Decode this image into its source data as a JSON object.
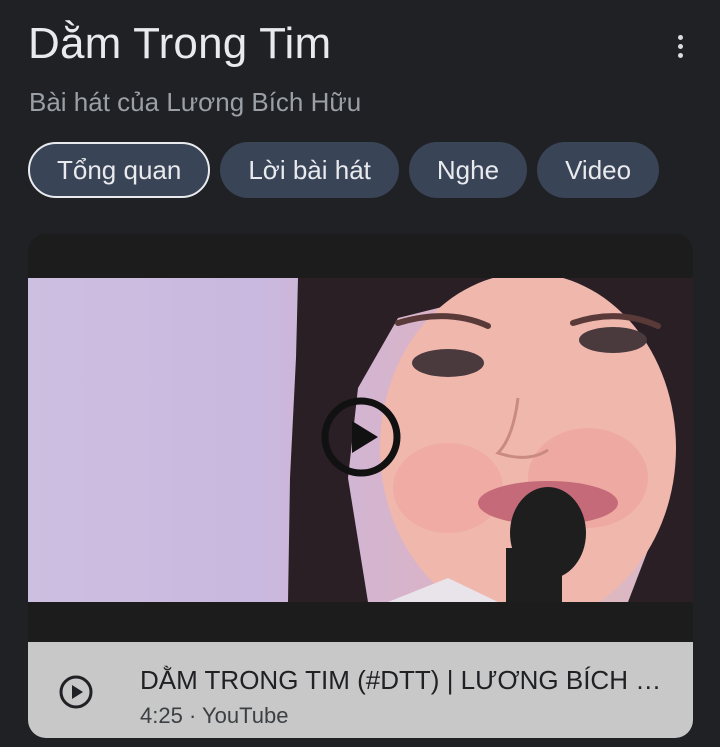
{
  "header": {
    "title": "Dằm Trong Tim",
    "subtitle": "Bài hát của Lương Bích Hữu",
    "more_icon": "more-vert-icon"
  },
  "tabs": [
    {
      "label": "Tổng quan",
      "active": true
    },
    {
      "label": "Lời bài hát",
      "active": false
    },
    {
      "label": "Nghe",
      "active": false
    },
    {
      "label": "Video",
      "active": false
    }
  ],
  "video": {
    "title": "DẰM TRONG TIM (#DTT) | LƯƠNG BÍCH H...",
    "duration": "4:25",
    "separator": "·",
    "source": "YouTube",
    "play_icon": "play-circle-icon"
  },
  "colors": {
    "background": "#202124",
    "chip": "#394457",
    "info_bar": "#c8c8c8"
  }
}
